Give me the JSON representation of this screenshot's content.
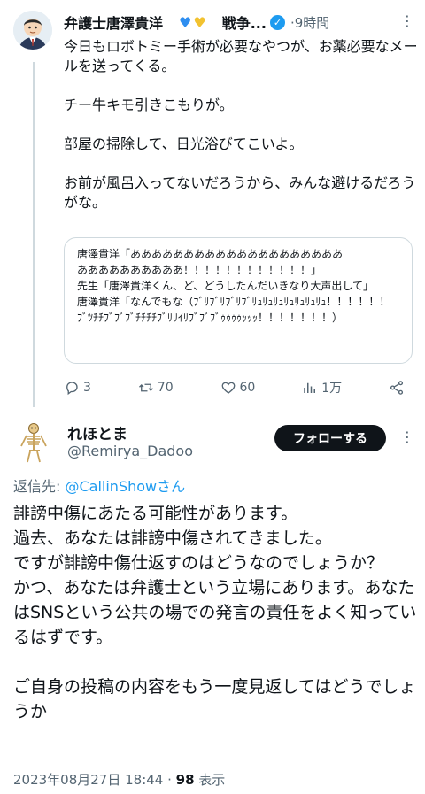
{
  "parent_tweet": {
    "author_name": "弁護士唐澤貴洋",
    "name_emoji": "💙💛",
    "name_suffix": "戦争...",
    "time": "9時間",
    "body": [
      "今日もロボトミー手術が必要なやつが、お薬必要なメールを送ってくる。",
      "チー牛キモ引きこもりが。",
      "部屋の掃除して、日光浴びてこいよ。",
      "お前が風呂入ってないだろうから、みんな避けるだろうがな。"
    ],
    "quote_lines": [
      "唐澤貴洋「ああああああああああああああああああああ",
      "ああああああああああ！！！！！！！！！！！！」",
      "先生「唐澤貴洋くん、ど、どうしたんだいきなり大声出して」",
      "唐澤貴洋「なんでもな（ﾌﾞﾘﾌﾞﾘﾌﾞﾘﾌﾞﾘｭﾘｭﾘｭﾘｭﾘｭﾘｭﾘｭ！！！！！！ﾌﾞﾂﾁﾁﾌﾞﾌﾞﾌﾞﾁﾁﾁﾁﾌﾞﾘﾘｲﾘﾌﾞﾌﾞﾌﾞｩｩｩｩｯｯｯ！！！！！！！）"
    ],
    "stats": {
      "replies": "3",
      "retweets": "70",
      "likes": "60",
      "views": "1万"
    }
  },
  "reply_tweet": {
    "author_name": "れほとま",
    "handle": "@Remirya_Dadoo",
    "follow_label": "フォローする",
    "reply_to_label": "返信先: ",
    "reply_to_mention": "@CallinShowさん",
    "body": [
      "誹謗中傷にあたる可能性があります。",
      "過去、あなたは誹謗中傷されてきました。",
      "ですが誹謗中傷仕返すのはどうなのでしょうか？",
      "かつ、あなたは弁護士という立場にあります。あなたはSNSという公共の場での発言の責任をよく知っているはずです。",
      "ご自身の投稿の内容をもう一度見返してはどうでしょうか"
    ],
    "timestamp": "2023年08月27日 18:44",
    "separator": " · ",
    "views_count": "98",
    "views_label": " 表示"
  },
  "icons": {
    "more": "more-icon",
    "reply": "reply-icon",
    "retweet": "retweet-icon",
    "like": "like-icon",
    "views": "views-icon",
    "share": "share-icon",
    "verified": "verified-badge-icon"
  },
  "colors": {
    "accent": "#1d9bf0",
    "text": "#0f1419",
    "secondary": "#536471",
    "border": "#cfd9de",
    "follow_button": "#0f1419"
  }
}
